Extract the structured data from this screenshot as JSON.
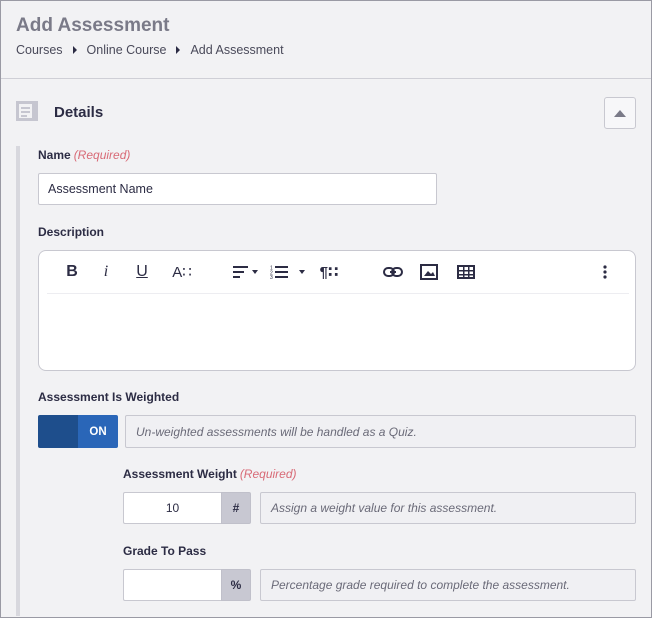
{
  "header": {
    "title": "Add Assessment",
    "breadcrumb": [
      "Courses",
      "Online Course",
      "Add Assessment"
    ]
  },
  "section": {
    "title": "Details",
    "collapse_label": ""
  },
  "name_field": {
    "label": "Name",
    "required": "(Required)",
    "value": "Assessment Name"
  },
  "description": {
    "label": "Description",
    "toolbar": {
      "bold": "B",
      "italic": "i",
      "underline": "U",
      "font_size": "A∷",
      "align_icon": "align-left-icon",
      "list_icon": "numbered-list-icon",
      "paragraph": "¶∷",
      "link_icon": "link-icon",
      "image_icon": "image-icon",
      "table_icon": "table-icon",
      "more_icon": "more-vertical-icon"
    },
    "value": ""
  },
  "weighted": {
    "label": "Assessment Is Weighted",
    "toggle_state": "ON",
    "hint": "Un-weighted assessments will be handled as a Quiz."
  },
  "weight": {
    "label": "Assessment Weight",
    "required": "(Required)",
    "value": "10",
    "addon": "#",
    "hint": "Assign a weight value for this assessment."
  },
  "grade": {
    "label": "Grade To Pass",
    "value": "",
    "addon": "%",
    "hint": "Percentage grade required to complete the assessment."
  },
  "colors": {
    "toggle_dark": "#1e4e8c",
    "toggle_light": "#2a66b8",
    "required": "#d86a76"
  }
}
